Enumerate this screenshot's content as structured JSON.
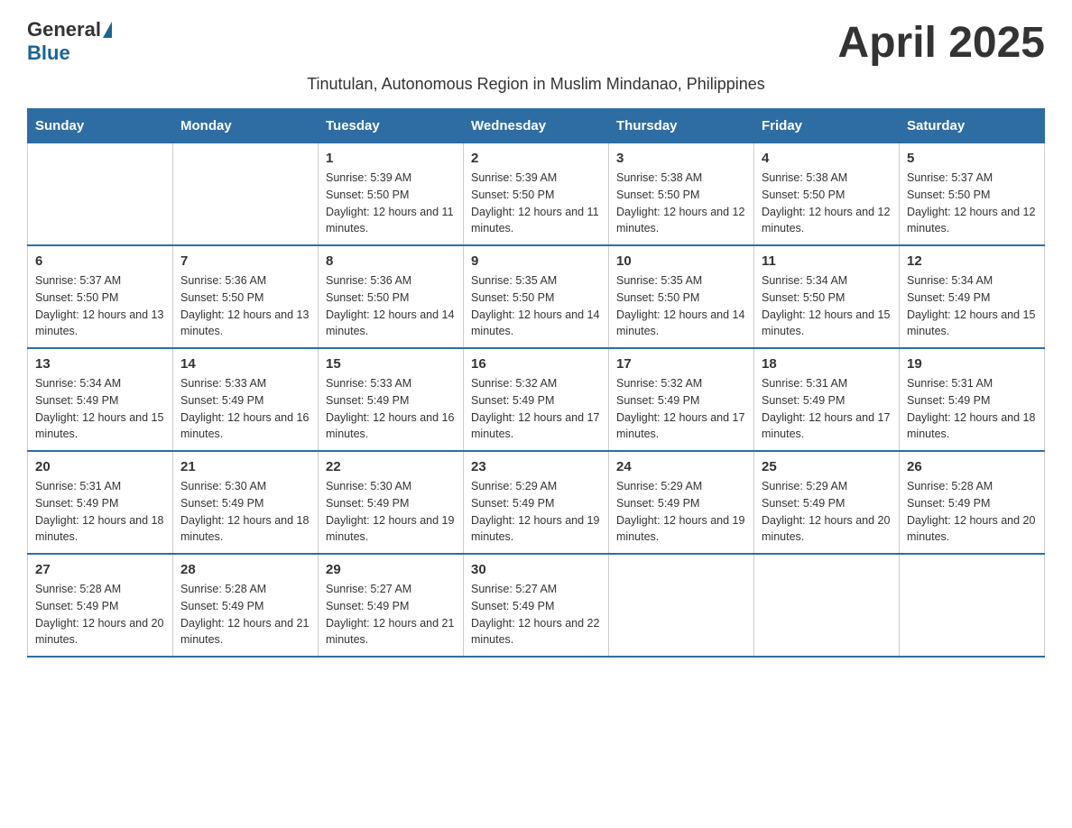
{
  "header": {
    "logo_general": "General",
    "logo_blue": "Blue",
    "title": "April 2025"
  },
  "subtitle": "Tinutulan, Autonomous Region in Muslim Mindanao, Philippines",
  "days_of_week": [
    "Sunday",
    "Monday",
    "Tuesday",
    "Wednesday",
    "Thursday",
    "Friday",
    "Saturday"
  ],
  "weeks": [
    [
      {
        "day": "",
        "sunrise": "",
        "sunset": "",
        "daylight": ""
      },
      {
        "day": "",
        "sunrise": "",
        "sunset": "",
        "daylight": ""
      },
      {
        "day": "1",
        "sunrise": "Sunrise: 5:39 AM",
        "sunset": "Sunset: 5:50 PM",
        "daylight": "Daylight: 12 hours and 11 minutes."
      },
      {
        "day": "2",
        "sunrise": "Sunrise: 5:39 AM",
        "sunset": "Sunset: 5:50 PM",
        "daylight": "Daylight: 12 hours and 11 minutes."
      },
      {
        "day": "3",
        "sunrise": "Sunrise: 5:38 AM",
        "sunset": "Sunset: 5:50 PM",
        "daylight": "Daylight: 12 hours and 12 minutes."
      },
      {
        "day": "4",
        "sunrise": "Sunrise: 5:38 AM",
        "sunset": "Sunset: 5:50 PM",
        "daylight": "Daylight: 12 hours and 12 minutes."
      },
      {
        "day": "5",
        "sunrise": "Sunrise: 5:37 AM",
        "sunset": "Sunset: 5:50 PM",
        "daylight": "Daylight: 12 hours and 12 minutes."
      }
    ],
    [
      {
        "day": "6",
        "sunrise": "Sunrise: 5:37 AM",
        "sunset": "Sunset: 5:50 PM",
        "daylight": "Daylight: 12 hours and 13 minutes."
      },
      {
        "day": "7",
        "sunrise": "Sunrise: 5:36 AM",
        "sunset": "Sunset: 5:50 PM",
        "daylight": "Daylight: 12 hours and 13 minutes."
      },
      {
        "day": "8",
        "sunrise": "Sunrise: 5:36 AM",
        "sunset": "Sunset: 5:50 PM",
        "daylight": "Daylight: 12 hours and 14 minutes."
      },
      {
        "day": "9",
        "sunrise": "Sunrise: 5:35 AM",
        "sunset": "Sunset: 5:50 PM",
        "daylight": "Daylight: 12 hours and 14 minutes."
      },
      {
        "day": "10",
        "sunrise": "Sunrise: 5:35 AM",
        "sunset": "Sunset: 5:50 PM",
        "daylight": "Daylight: 12 hours and 14 minutes."
      },
      {
        "day": "11",
        "sunrise": "Sunrise: 5:34 AM",
        "sunset": "Sunset: 5:50 PM",
        "daylight": "Daylight: 12 hours and 15 minutes."
      },
      {
        "day": "12",
        "sunrise": "Sunrise: 5:34 AM",
        "sunset": "Sunset: 5:49 PM",
        "daylight": "Daylight: 12 hours and 15 minutes."
      }
    ],
    [
      {
        "day": "13",
        "sunrise": "Sunrise: 5:34 AM",
        "sunset": "Sunset: 5:49 PM",
        "daylight": "Daylight: 12 hours and 15 minutes."
      },
      {
        "day": "14",
        "sunrise": "Sunrise: 5:33 AM",
        "sunset": "Sunset: 5:49 PM",
        "daylight": "Daylight: 12 hours and 16 minutes."
      },
      {
        "day": "15",
        "sunrise": "Sunrise: 5:33 AM",
        "sunset": "Sunset: 5:49 PM",
        "daylight": "Daylight: 12 hours and 16 minutes."
      },
      {
        "day": "16",
        "sunrise": "Sunrise: 5:32 AM",
        "sunset": "Sunset: 5:49 PM",
        "daylight": "Daylight: 12 hours and 17 minutes."
      },
      {
        "day": "17",
        "sunrise": "Sunrise: 5:32 AM",
        "sunset": "Sunset: 5:49 PM",
        "daylight": "Daylight: 12 hours and 17 minutes."
      },
      {
        "day": "18",
        "sunrise": "Sunrise: 5:31 AM",
        "sunset": "Sunset: 5:49 PM",
        "daylight": "Daylight: 12 hours and 17 minutes."
      },
      {
        "day": "19",
        "sunrise": "Sunrise: 5:31 AM",
        "sunset": "Sunset: 5:49 PM",
        "daylight": "Daylight: 12 hours and 18 minutes."
      }
    ],
    [
      {
        "day": "20",
        "sunrise": "Sunrise: 5:31 AM",
        "sunset": "Sunset: 5:49 PM",
        "daylight": "Daylight: 12 hours and 18 minutes."
      },
      {
        "day": "21",
        "sunrise": "Sunrise: 5:30 AM",
        "sunset": "Sunset: 5:49 PM",
        "daylight": "Daylight: 12 hours and 18 minutes."
      },
      {
        "day": "22",
        "sunrise": "Sunrise: 5:30 AM",
        "sunset": "Sunset: 5:49 PM",
        "daylight": "Daylight: 12 hours and 19 minutes."
      },
      {
        "day": "23",
        "sunrise": "Sunrise: 5:29 AM",
        "sunset": "Sunset: 5:49 PM",
        "daylight": "Daylight: 12 hours and 19 minutes."
      },
      {
        "day": "24",
        "sunrise": "Sunrise: 5:29 AM",
        "sunset": "Sunset: 5:49 PM",
        "daylight": "Daylight: 12 hours and 19 minutes."
      },
      {
        "day": "25",
        "sunrise": "Sunrise: 5:29 AM",
        "sunset": "Sunset: 5:49 PM",
        "daylight": "Daylight: 12 hours and 20 minutes."
      },
      {
        "day": "26",
        "sunrise": "Sunrise: 5:28 AM",
        "sunset": "Sunset: 5:49 PM",
        "daylight": "Daylight: 12 hours and 20 minutes."
      }
    ],
    [
      {
        "day": "27",
        "sunrise": "Sunrise: 5:28 AM",
        "sunset": "Sunset: 5:49 PM",
        "daylight": "Daylight: 12 hours and 20 minutes."
      },
      {
        "day": "28",
        "sunrise": "Sunrise: 5:28 AM",
        "sunset": "Sunset: 5:49 PM",
        "daylight": "Daylight: 12 hours and 21 minutes."
      },
      {
        "day": "29",
        "sunrise": "Sunrise: 5:27 AM",
        "sunset": "Sunset: 5:49 PM",
        "daylight": "Daylight: 12 hours and 21 minutes."
      },
      {
        "day": "30",
        "sunrise": "Sunrise: 5:27 AM",
        "sunset": "Sunset: 5:49 PM",
        "daylight": "Daylight: 12 hours and 22 minutes."
      },
      {
        "day": "",
        "sunrise": "",
        "sunset": "",
        "daylight": ""
      },
      {
        "day": "",
        "sunrise": "",
        "sunset": "",
        "daylight": ""
      },
      {
        "day": "",
        "sunrise": "",
        "sunset": "",
        "daylight": ""
      }
    ]
  ]
}
